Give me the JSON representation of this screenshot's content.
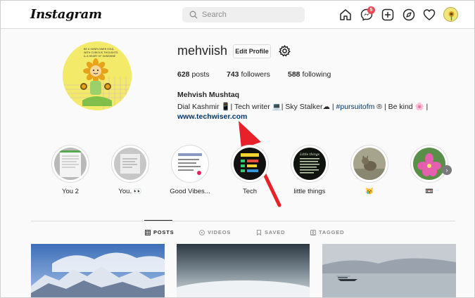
{
  "nav": {
    "logo": "Instagram",
    "search_placeholder": "Search",
    "messenger_badge": "5",
    "icons": [
      "home-icon",
      "messenger-icon",
      "new-post-icon",
      "explore-icon",
      "activity-heart-icon",
      "profile-avatar"
    ]
  },
  "profile": {
    "username": "mehviish",
    "edit_label": "Edit Profile",
    "stats": [
      {
        "value": "628",
        "label": "posts"
      },
      {
        "value": "743",
        "label": "followers"
      },
      {
        "value": "588",
        "label": "following"
      }
    ],
    "full_name": "Mehvish Mushtaq",
    "bio_prefix": "Dial Kashmir 📱| Tech writer 💻| Sky Stalker☁ | ",
    "bio_hashtag": "#pursuitofm",
    "bio_suffix": " ® | Be kind 🌸 |",
    "website": "www.techwiser.com",
    "profile_pic_text": "BE A SUNFLOWER SOUL WITH CURIOUS THOUGHTS & A HEART OF SUNSHINE"
  },
  "highlights": [
    {
      "label": "You 2"
    },
    {
      "label": "You. 👀"
    },
    {
      "label": "Good Vibes..."
    },
    {
      "label": "Tech"
    },
    {
      "label": "little things"
    },
    {
      "label": "😿"
    },
    {
      "label": "📼"
    }
  ],
  "tabs": [
    {
      "label": "POSTS",
      "active": true
    },
    {
      "label": "VIDEOS",
      "active": false
    },
    {
      "label": "SAVED",
      "active": false
    },
    {
      "label": "TAGGED",
      "active": false
    }
  ],
  "colors": {
    "link": "#00376b",
    "annotation_arrow": "#e8202a",
    "badge": "#ed4956"
  }
}
